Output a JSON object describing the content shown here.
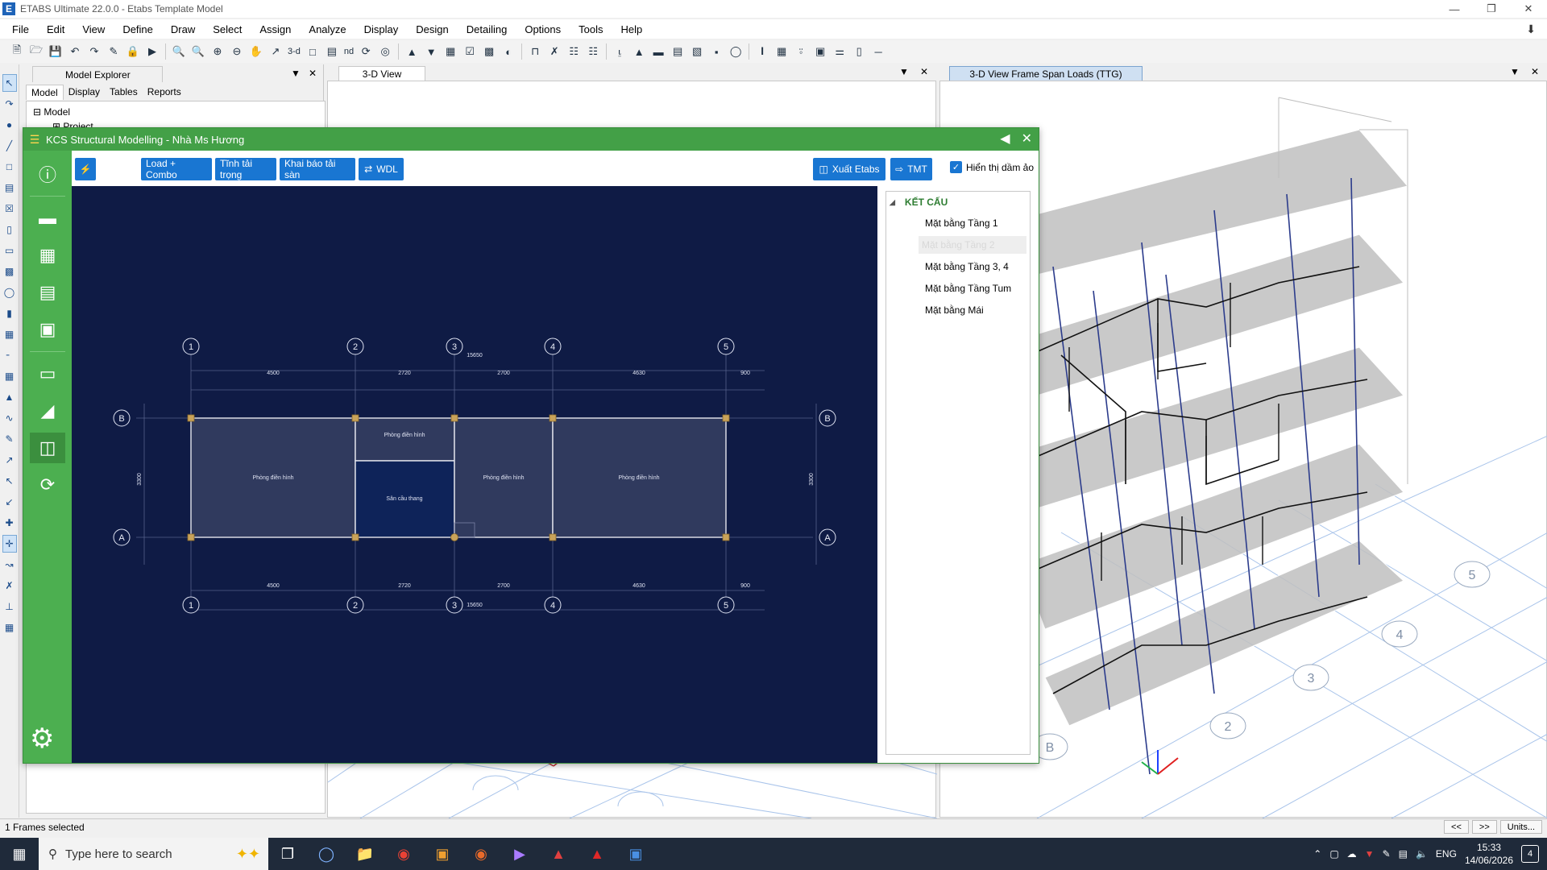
{
  "window": {
    "title": "ETABS Ultimate 22.0.0 - Etabs Template Model",
    "app_letter": "E"
  },
  "menu": [
    "File",
    "Edit",
    "View",
    "Define",
    "Draw",
    "Select",
    "Assign",
    "Analyze",
    "Display",
    "Design",
    "Detailing",
    "Options",
    "Tools",
    "Help"
  ],
  "toolbar": {
    "label_3d": "3-d",
    "label_nd": "nd"
  },
  "explorer": {
    "pane_title": "Model Explorer",
    "tabs": [
      "Model",
      "Display",
      "Tables",
      "Reports"
    ],
    "tree": [
      "Model",
      "Project"
    ]
  },
  "views": {
    "left_tab": "3-D View",
    "right_tab": "3-D View  Frame Span Loads (TTG)"
  },
  "kcs": {
    "title": "KCS Structural Modelling - Nhà Ms Hương",
    "buttons": {
      "load_combo": "Load + Combo",
      "tinh_tai": "Tĩnh tải trọng",
      "khai_bao": "Khai báo tải sàn",
      "wdl": "WDL",
      "xuat_etabs": "Xuất Etabs",
      "tmt": "TMT"
    },
    "checkbox": {
      "label": "Hiển thị dầm ảo",
      "checked": true
    },
    "tree": {
      "root": "KẾT CẤU",
      "items": [
        "Mặt bằng Tầng 1",
        "Mặt bằng Tầng 2",
        "Mặt bằng Tầng 3, 4",
        "Mặt bằng Tầng Tum",
        "Mặt bằng Mái"
      ],
      "selected_index": 1
    },
    "plan": {
      "grid_x": [
        "1",
        "2",
        "3",
        "4",
        "5"
      ],
      "grid_y": [
        "B",
        "A"
      ],
      "total_dim": "15650",
      "spans": [
        "4500",
        "2720",
        "2700",
        "4630",
        "900"
      ],
      "depth_dim": "3300",
      "rooms": [
        "Phòng điền hình",
        "Phòng điền hình",
        "Sân cầu thang",
        "Phòng điền hình",
        "Phòng điền hình"
      ]
    }
  },
  "status": {
    "message": "1 Frames selected",
    "btn_prev": "<<",
    "btn_next": ">>",
    "btn_units": "Units..."
  },
  "taskbar": {
    "search_placeholder": "Type here to search",
    "lang": "ENG",
    "time": "15:33",
    "date": "14/06/2026",
    "notifications": "4"
  },
  "grid3d_labels": [
    "5",
    "4",
    "3",
    "2",
    "B"
  ],
  "colors": {
    "kcs_green": "#4caf50",
    "canvas_bg": "#0f1b45",
    "button_blue": "#1976d2"
  }
}
